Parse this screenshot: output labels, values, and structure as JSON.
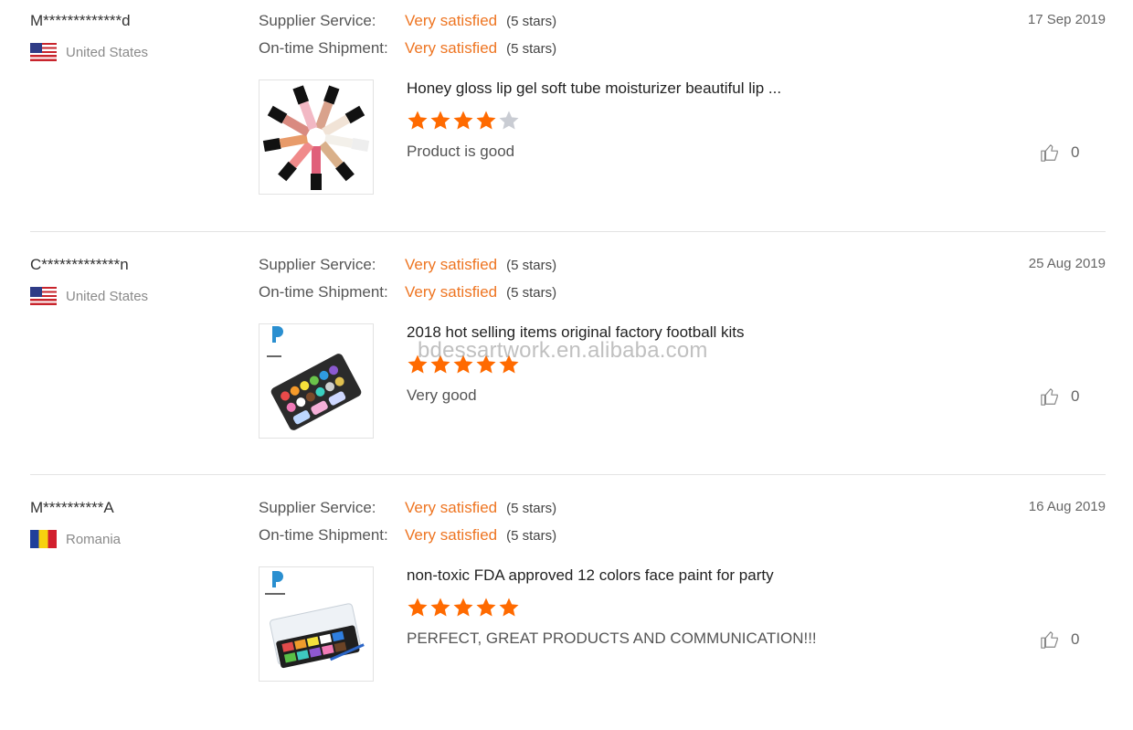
{
  "labels": {
    "supplier_service": "Supplier Service:",
    "ontime_shipment": "On-time Shipment:"
  },
  "colors": {
    "accent": "#ee7522",
    "star_filled": "#ff6a00",
    "star_empty": "#c9ccd3"
  },
  "watermark": "bdessartwork.en.alibaba.com",
  "reviews": [
    {
      "user": "M*************d",
      "country": "United States",
      "flag": "us",
      "supplier_service": "Very satisfied",
      "supplier_stars": "(5 stars)",
      "shipment": "Very satisfied",
      "shipment_stars": "(5 stars)",
      "date": "17 Sep 2019",
      "product_title": "Honey gloss lip gel soft tube moisturizer beautiful lip ...",
      "rating": 4,
      "comment": "Product is good",
      "likes": "0"
    },
    {
      "user": "C*************n",
      "country": "United States",
      "flag": "us",
      "supplier_service": "Very satisfied",
      "supplier_stars": "(5 stars)",
      "shipment": "Very satisfied",
      "shipment_stars": "(5 stars)",
      "date": "25 Aug 2019",
      "product_title": "2018 hot selling items original factory football kits",
      "rating": 5,
      "comment": "Very good",
      "likes": "0"
    },
    {
      "user": "M**********A",
      "country": "Romania",
      "flag": "ro",
      "supplier_service": "Very satisfied",
      "supplier_stars": "(5 stars)",
      "shipment": "Very satisfied",
      "shipment_stars": "(5 stars)",
      "date": "16 Aug 2019",
      "product_title": "non-toxic FDA approved 12 colors face paint for party",
      "rating": 5,
      "comment": "PERFECT, GREAT PRODUCTS AND COMMUNICATION!!!",
      "likes": "0"
    }
  ]
}
